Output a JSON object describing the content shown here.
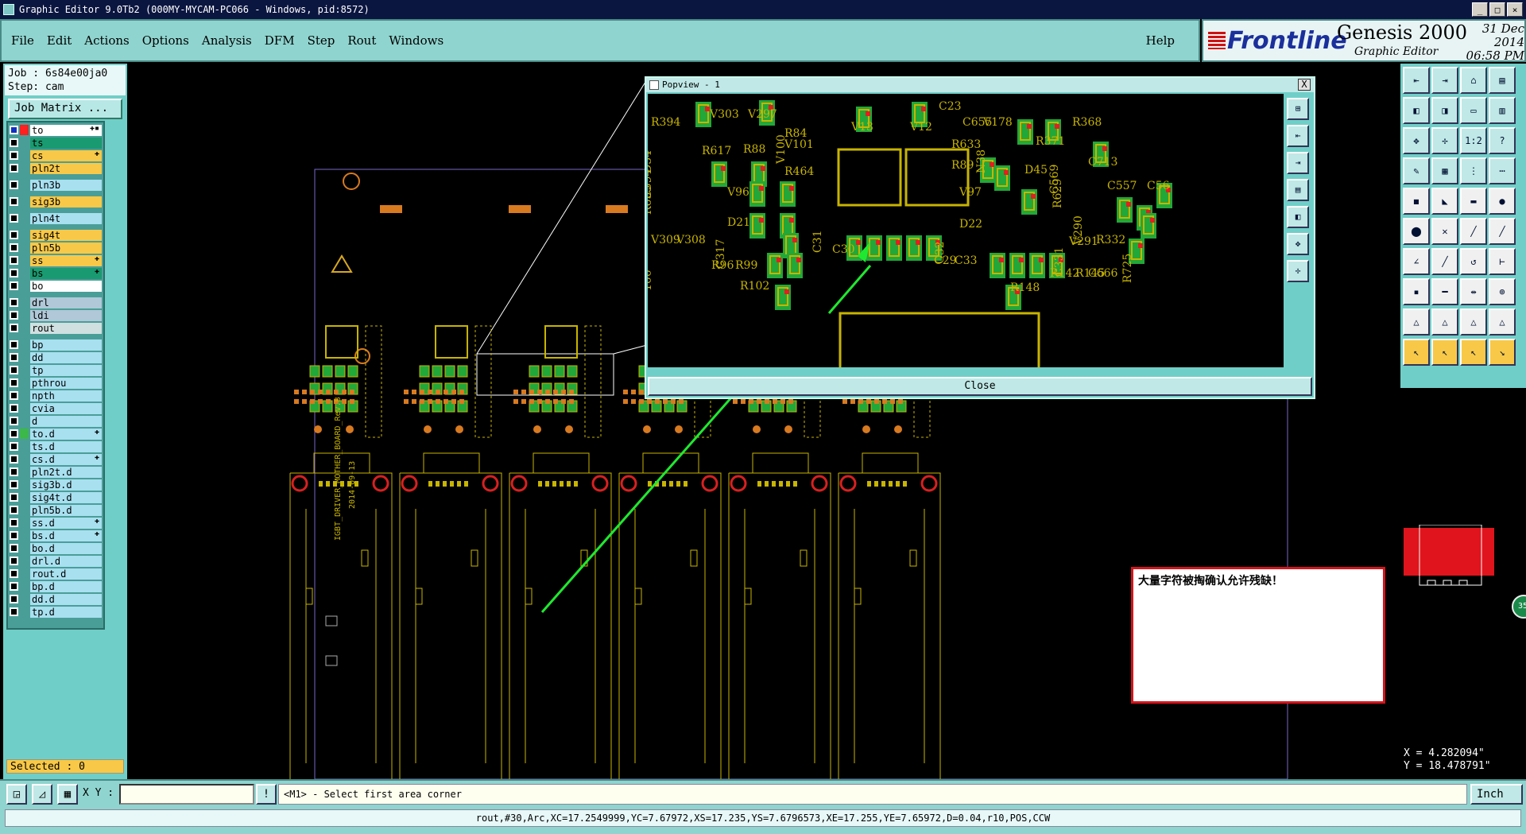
{
  "window": {
    "title": "Graphic Editor 9.0Tb2 (000MY-MYCAM-PC066 - Windows, pid:8572)"
  },
  "menu": {
    "items": [
      "File",
      "Edit",
      "Actions",
      "Options",
      "Analysis",
      "DFM",
      "Step",
      "Rout",
      "Windows"
    ],
    "help": "Help"
  },
  "brand": {
    "logo": "Frontline",
    "product": "Genesis 2000",
    "subtitle": "Graphic Editor",
    "date": "31 Dec 2014",
    "time": "06:58 PM"
  },
  "job": {
    "job_line": "Job : 6s84e00ja0",
    "step_line": "Step: cam",
    "matrix_button": "Job Matrix ..."
  },
  "layers": [
    {
      "name": "to",
      "color": "#ffffff",
      "mark": "#ff2020",
      "flag": "✚▪"
    },
    {
      "name": "ts",
      "color": "#1a9a70",
      "mark": "",
      "flag": ""
    },
    {
      "name": "cs",
      "color": "#f8c848",
      "mark": "",
      "flag": "✚"
    },
    {
      "name": "pln2t",
      "color": "#f8c848",
      "mark": "",
      "flag": ""
    },
    {
      "gap": true
    },
    {
      "name": "pln3b",
      "color": "#a8e0f0",
      "mark": "",
      "flag": ""
    },
    {
      "gap": true
    },
    {
      "name": "sig3b",
      "color": "#f8c848",
      "mark": "",
      "flag": ""
    },
    {
      "gap": true
    },
    {
      "name": "pln4t",
      "color": "#a8e0f0",
      "mark": "",
      "flag": ""
    },
    {
      "gap": true
    },
    {
      "name": "sig4t",
      "color": "#f8c848",
      "mark": "",
      "flag": ""
    },
    {
      "name": "pln5b",
      "color": "#f8c848",
      "mark": "",
      "flag": ""
    },
    {
      "name": "ss",
      "color": "#f8c848",
      "mark": "",
      "flag": "✚"
    },
    {
      "name": "bs",
      "color": "#1a9a70",
      "mark": "",
      "flag": "✚"
    },
    {
      "name": "bo",
      "color": "#ffffff",
      "mark": "",
      "flag": ""
    },
    {
      "gap": true
    },
    {
      "name": "drl",
      "color": "#b0c8d8",
      "mark": "",
      "flag": ""
    },
    {
      "name": "ldi",
      "color": "#b0c8d8",
      "mark": "",
      "flag": ""
    },
    {
      "name": "rout",
      "color": "#d0e0e0",
      "mark": "",
      "flag": ""
    },
    {
      "gap": true
    },
    {
      "name": "bp",
      "color": "#a8e0f0",
      "mark": "",
      "flag": ""
    },
    {
      "name": "dd",
      "color": "#a8e0f0",
      "mark": "",
      "flag": ""
    },
    {
      "name": "tp",
      "color": "#a8e0f0",
      "mark": "",
      "flag": ""
    },
    {
      "name": "pthrou",
      "color": "#a8e0f0",
      "mark": "",
      "flag": ""
    },
    {
      "name": "npth",
      "color": "#a8e0f0",
      "mark": "",
      "flag": ""
    },
    {
      "name": "cvia",
      "color": "#a8e0f0",
      "mark": "",
      "flag": ""
    },
    {
      "name": "d",
      "color": "#a8e0f0",
      "mark": "",
      "flag": ""
    },
    {
      "name": "to.d",
      "color": "#a8e0f0",
      "mark": "#3cb84a",
      "flag": "✚"
    },
    {
      "name": "ts.d",
      "color": "#a8e0f0",
      "mark": "",
      "flag": ""
    },
    {
      "name": "cs.d",
      "color": "#a8e0f0",
      "mark": "",
      "flag": "✚"
    },
    {
      "name": "pln2t.d",
      "color": "#a8e0f0",
      "mark": "",
      "flag": ""
    },
    {
      "name": "sig3b.d",
      "color": "#a8e0f0",
      "mark": "",
      "flag": ""
    },
    {
      "name": "sig4t.d",
      "color": "#a8e0f0",
      "mark": "",
      "flag": ""
    },
    {
      "name": "pln5b.d",
      "color": "#a8e0f0",
      "mark": "",
      "flag": ""
    },
    {
      "name": "ss.d",
      "color": "#a8e0f0",
      "mark": "",
      "flag": "✚"
    },
    {
      "name": "bs.d",
      "color": "#a8e0f0",
      "mark": "",
      "flag": "✚"
    },
    {
      "name": "bo.d",
      "color": "#a8e0f0",
      "mark": "",
      "flag": ""
    },
    {
      "name": "drl.d",
      "color": "#a8e0f0",
      "mark": "",
      "flag": ""
    },
    {
      "name": "rout.d",
      "color": "#a8e0f0",
      "mark": "",
      "flag": ""
    },
    {
      "name": "bp.d",
      "color": "#a8e0f0",
      "mark": "",
      "flag": ""
    },
    {
      "name": "dd.d",
      "color": "#a8e0f0",
      "mark": "",
      "flag": ""
    },
    {
      "name": "tp.d",
      "color": "#a8e0f0",
      "mark": "",
      "flag": ""
    }
  ],
  "selected": "Selected : 0",
  "popview": {
    "title": "Popview - 1",
    "close_label": "Close",
    "close_x": "X",
    "labels": [
      "R394",
      "V303",
      "V297",
      "R84",
      "V101",
      "V13",
      "V12",
      "C23",
      "C655",
      "V178",
      "R633",
      "R371",
      "R368",
      "D54",
      "R617",
      "R88",
      "V100",
      "R464",
      "R89",
      "N38",
      "D45",
      "C713",
      "C594",
      "V96",
      "V97",
      "C569",
      "C557",
      "C56",
      "R659",
      "D21",
      "D22",
      "R629",
      "V309",
      "V308",
      "C31",
      "C30",
      "C29",
      "C32",
      "C33",
      "V291",
      "V290",
      "R332",
      "R96",
      "C317",
      "R99",
      "R142",
      "C331",
      "R145",
      "C666",
      "R725",
      "R102",
      "R148",
      "100"
    ]
  },
  "msgbox": {
    "text": "大量字符被掏确认允许残缺！"
  },
  "coords": {
    "x": "X = 4.282094\"",
    "y": "Y = 18.478791\""
  },
  "bottom": {
    "xy_label": "X Y :",
    "xy_value": "",
    "warn": "!",
    "prompt": "<M1> - Select first area corner",
    "units": "Inch"
  },
  "status": "rout,#30,Arc,XC=17.2549999,YC=7.67972,XS=17.235,YS=7.6796573,XE=17.255,YE=7.65972,D=0.04,r10,POS,CCW",
  "badge": "35",
  "board": {
    "vertical_text": "IGBT_DRIVER_MOTHER_BOARD_Rev.B",
    "date_text": "2014-09-13"
  },
  "colors": {
    "teal_panel": "#8fd4cf",
    "trace_yellow": "#c8b400",
    "pad_green": "#22a838",
    "highlight_red": "#d4141c",
    "arrow_green": "#20e830"
  }
}
